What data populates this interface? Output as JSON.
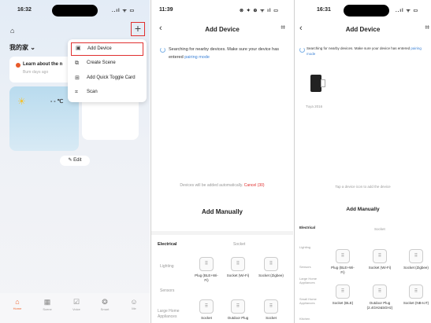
{
  "panel1": {
    "status": {
      "time": "16:32",
      "signal": "..ıl ᯤ ▭"
    },
    "home_icon": "home-icon",
    "home_name": "我的家 ⌄",
    "plus": "+",
    "learn_card": {
      "title": "Learn about the n",
      "subtitle": "Bum·days ago"
    },
    "weather_temp": "- - ℃",
    "menu": [
      {
        "label": "Add Device",
        "icon": "▣",
        "selected": true
      },
      {
        "label": "Create Scene",
        "icon": "⧉",
        "selected": false
      },
      {
        "label": "Add Quick Toggle Card",
        "icon": "⊞",
        "selected": false
      },
      {
        "label": "Scan",
        "icon": "⌗",
        "selected": false
      }
    ],
    "edit": "✎ Edit",
    "tabs": [
      {
        "label": "Home",
        "icon": "⌂",
        "active": true
      },
      {
        "label": "Scene",
        "icon": "▦",
        "active": false
      },
      {
        "label": "Voice",
        "icon": "☑",
        "active": false
      },
      {
        "label": "Smart",
        "icon": "❂",
        "active": false
      },
      {
        "label": "Me",
        "icon": "☺",
        "active": false
      }
    ]
  },
  "panel2": {
    "status": {
      "time": "11:39",
      "signal": "⊗ ✦ ⊕ ᯤ ıl ▭"
    },
    "title": "Add Device",
    "searching_text": "Searching for nearby devices. Make sure your device has entered ",
    "pairing_link": "pairing mode",
    "auto_note": "Devices will be added automatically. ",
    "cancel_link": "Cancel (30)",
    "add_manually": "Add Manually",
    "electrical": "Electrical",
    "socket": "Socket",
    "categories": [
      "Lighting",
      "Sensors",
      "Large Home Appliances"
    ],
    "devices": [
      {
        "name": "Plug (BLE+Wi-Fi)"
      },
      {
        "name": "Socket (Wi-Fi)"
      },
      {
        "name": "Socket (Zigbee)"
      },
      {
        "name": "Socket"
      },
      {
        "name": "Outdoor Plug"
      },
      {
        "name": "Socket"
      }
    ]
  },
  "panel3": {
    "status": {
      "time": "16:31",
      "signal": "..ıl ᯤ ▭"
    },
    "title": "Add Device",
    "searching_text": "Searching for nearby devices. Make sure your device has entered ",
    "pairing_link": "pairing mode",
    "device_name": "Tuya 2016",
    "tap_note": "Tap a device icon to add the device",
    "add_manually": "Add Manually",
    "electrical": "Electrical",
    "socket": "Socket",
    "categories": [
      "Lighting",
      "Sensors",
      "Large Home Appliances",
      "Small Home Appliances",
      "Kitchen"
    ],
    "devices": [
      {
        "name": "Plug (BLE+Wi-Fi)"
      },
      {
        "name": "Socket (Wi-Fi)"
      },
      {
        "name": "Socket (Zigbee)"
      },
      {
        "name": "Socket (BLE)"
      },
      {
        "name": "Outdoor Plug (2.4GHz&5GHz)"
      },
      {
        "name": "Socket (NB-IoT)"
      }
    ]
  }
}
